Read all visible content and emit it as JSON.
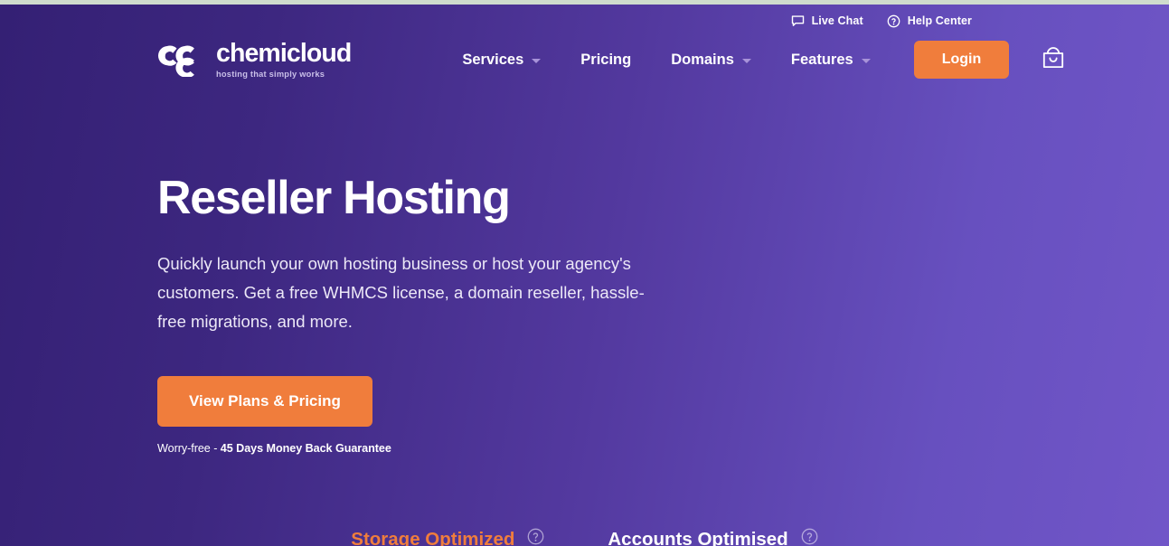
{
  "colors": {
    "bg_gradient_start": "#342074",
    "bg_gradient_end": "#7156c8",
    "accent_orange": "#f07d3c",
    "text_white": "#ffffff",
    "tagline_muted": "#c9bfe8",
    "caret_muted": "#a893d9"
  },
  "utility_bar": {
    "items": [
      {
        "label": "Live Chat",
        "icon": "chat-bubble-icon"
      },
      {
        "label": "Help Center",
        "icon": "question-circle-icon"
      }
    ]
  },
  "header": {
    "logo": {
      "icon": "chemicloud-c-mark-icon",
      "wordmark": "chemicloud",
      "tagline": "hosting that simply works"
    },
    "nav": [
      {
        "label": "Services",
        "has_dropdown": true
      },
      {
        "label": "Pricing",
        "has_dropdown": false
      },
      {
        "label": "Domains",
        "has_dropdown": true
      },
      {
        "label": "Features",
        "has_dropdown": true
      }
    ],
    "login_label": "Login",
    "cart_icon": "shopping-bag-icon"
  },
  "hero": {
    "title": "Reseller Hosting",
    "subtitle": "Quickly launch your own hosting business or host your agency's customers. Get a free WHMCS license, a domain reseller, hassle-free migrations, and more.",
    "cta_label": "View Plans & Pricing",
    "guarantee_prefix": "Worry-free - ",
    "guarantee_bold": "45 Days Money Back Guarantee"
  },
  "tabs": [
    {
      "label": "Storage Optimized",
      "active": true,
      "help_icon": "question-circle-icon"
    },
    {
      "label": "Accounts Optimised",
      "active": false,
      "help_icon": "question-circle-icon"
    }
  ]
}
